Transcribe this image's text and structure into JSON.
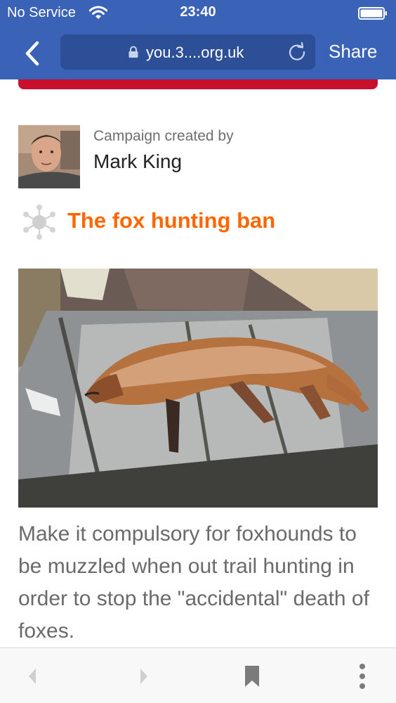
{
  "status_bar": {
    "carrier": "No Service",
    "time": "23:40"
  },
  "browser": {
    "url": "you.3....org.uk",
    "share_label": "Share"
  },
  "creator": {
    "label": "Campaign created by",
    "name": "Mark King"
  },
  "campaign": {
    "title": "The fox hunting ban",
    "description": "Make it compulsory for foxhounds to be muzzled when out trail hunting in order to stop the \"accidental\" death of foxes."
  },
  "colors": {
    "browser_bar": "#3a63b8",
    "url_field": "#2c4f97",
    "title_orange": "#ff6600",
    "banner_red": "#c8102e"
  },
  "icons": {
    "back": "chevron-left-icon",
    "lock": "lock-icon",
    "reload": "reload-icon",
    "wifi": "wifi-icon",
    "battery": "battery-icon",
    "campaign": "virus-icon",
    "toolbar": [
      "back-arrow-icon",
      "forward-arrow-icon",
      "bookmark-icon",
      "more-vertical-icon"
    ]
  }
}
